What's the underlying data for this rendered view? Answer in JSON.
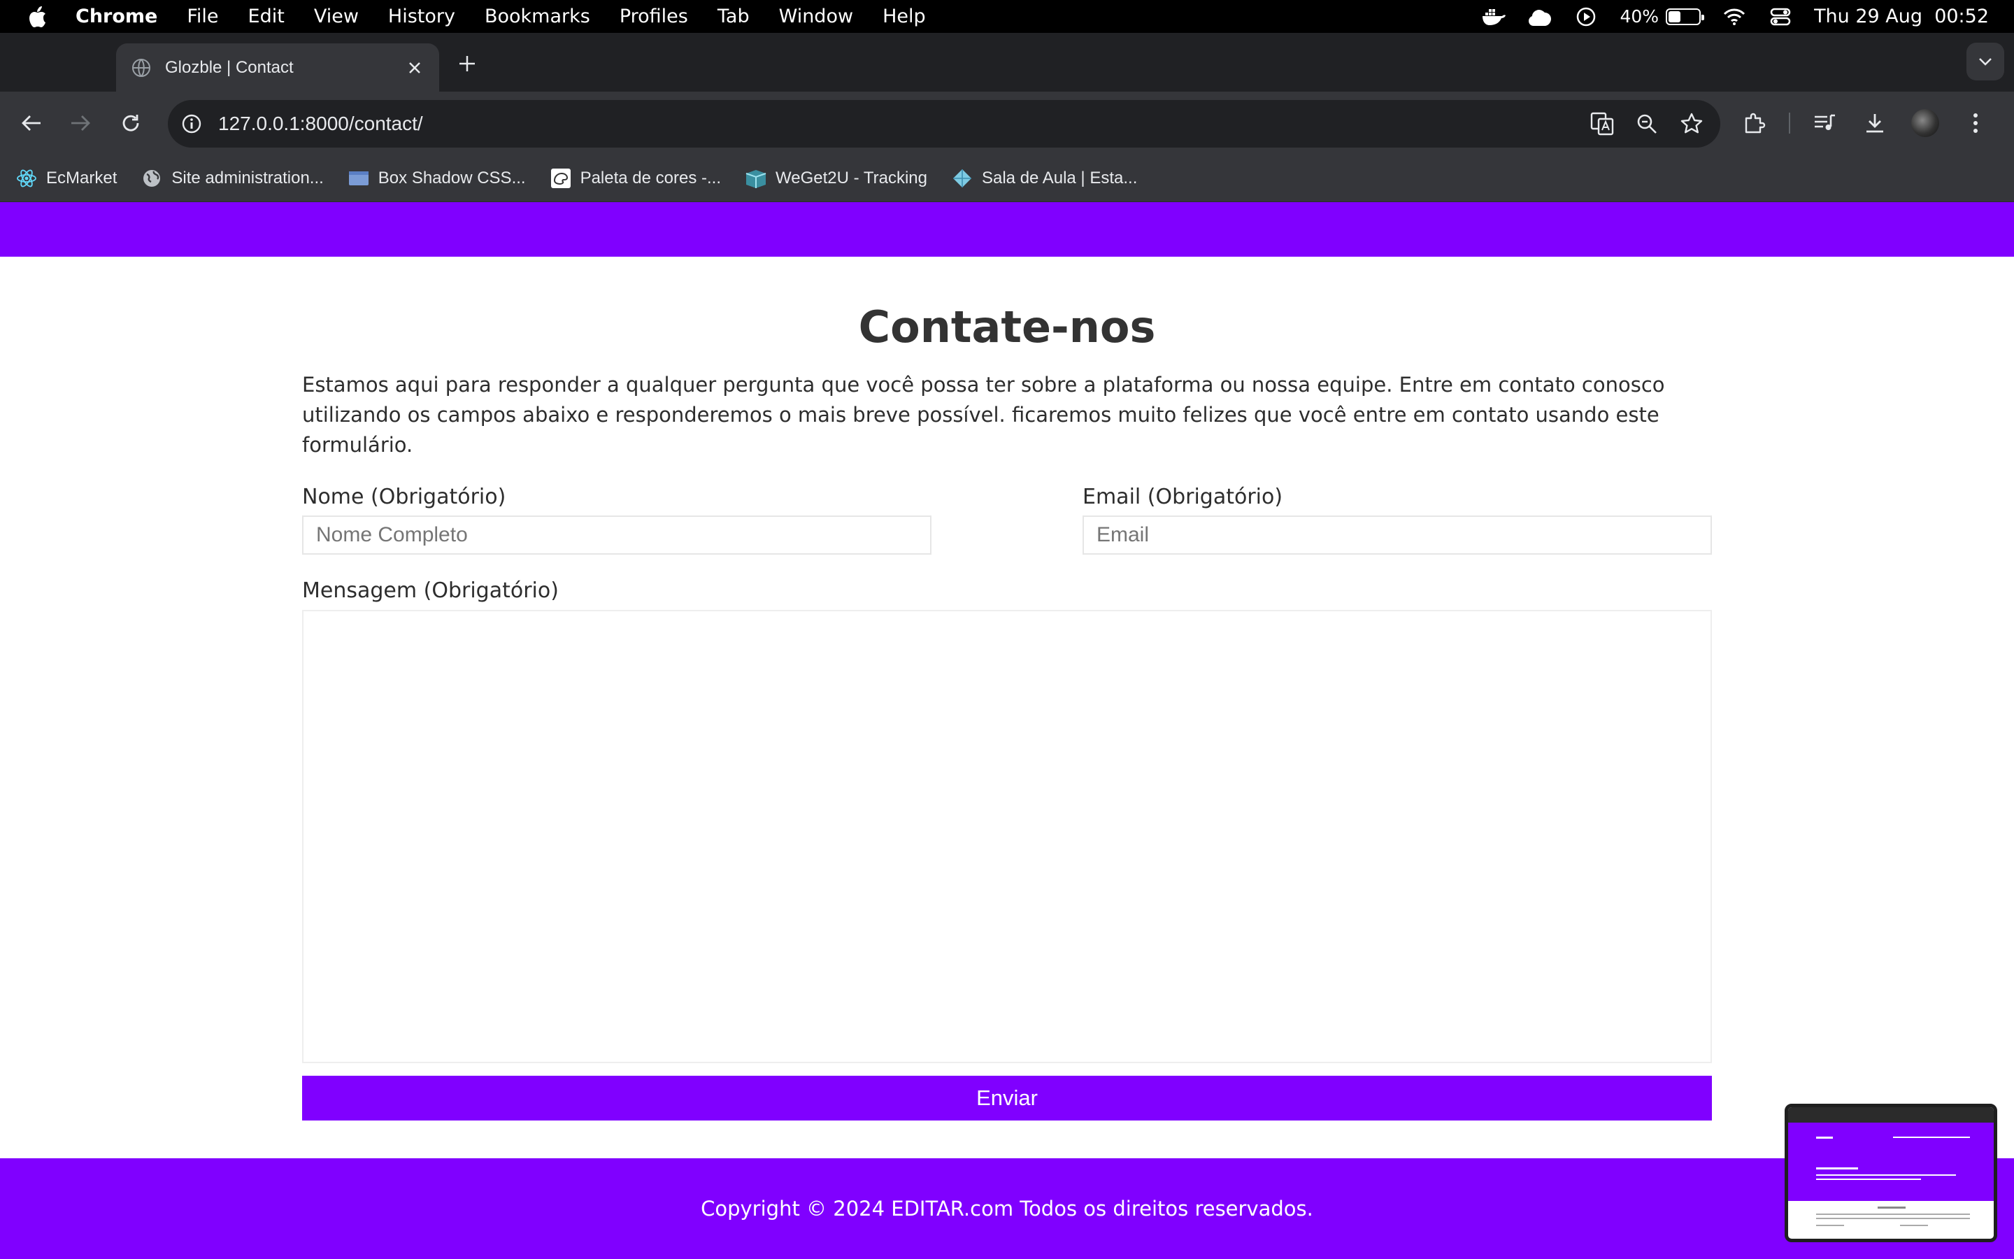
{
  "menubar": {
    "app_name": "Chrome",
    "menus": [
      "File",
      "Edit",
      "View",
      "History",
      "Bookmarks",
      "Profiles",
      "Tab",
      "Window",
      "Help"
    ],
    "battery_percent": "40%",
    "battery_level": 0.4,
    "datetime": "Thu 29 Aug  00:52"
  },
  "browser": {
    "tab_title": "Glozble | Contact",
    "url": "127.0.0.1:8000/contact/",
    "bookmarks": [
      {
        "label": "EcMarket",
        "icon": "react-icon"
      },
      {
        "label": "Site administration...",
        "icon": "globe-icon"
      },
      {
        "label": "Box Shadow CSS...",
        "icon": "folder-icon"
      },
      {
        "label": "Paleta de cores -...",
        "icon": "palette-icon"
      },
      {
        "label": "WeGet2U - Tracking",
        "icon": "tracking-icon"
      },
      {
        "label": "Sala de Aula | Esta...",
        "icon": "diamond-icon"
      }
    ]
  },
  "page": {
    "title": "Contate-nos",
    "intro": "Estamos aqui para responder a qualquer pergunta que você possa ter sobre a plataforma ou nossa equipe. Entre em contato conosco utilizando os campos abaixo e responderemos o mais breve possível. ficaremos muito felizes que você entre em contato usando este formulário.",
    "form": {
      "name_label": "Nome (Obrigatório)",
      "name_placeholder": "Nome Completo",
      "name_value": "",
      "email_label": "Email (Obrigatório)",
      "email_placeholder": "Email",
      "email_value": "",
      "message_label": "Mensagem (Obrigatório)",
      "message_value": "",
      "submit_label": "Enviar"
    },
    "footer": "Copyright © 2024 EDITAR.com Todos os direitos reservados."
  },
  "colors": {
    "brand": "#8000ff",
    "menubar": "#000000",
    "browser_chrome": "#35363a",
    "tabstrip": "#202124"
  }
}
